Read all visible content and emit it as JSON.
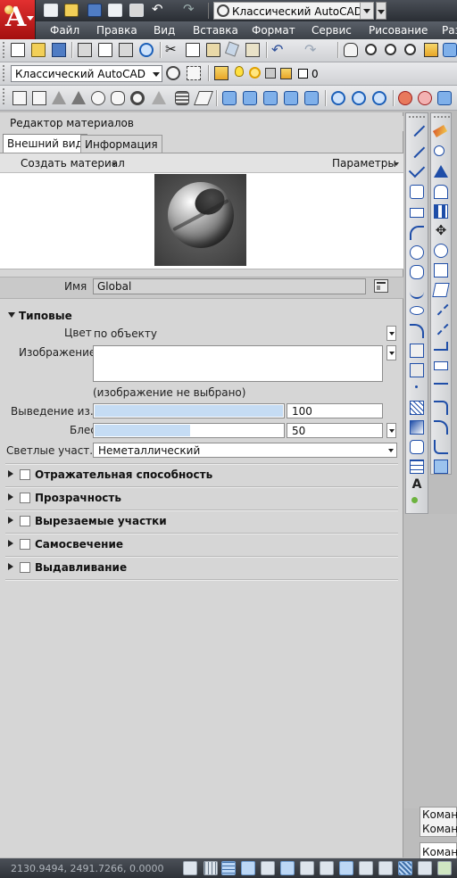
{
  "title_bar": {
    "workspace": "Классический AutoCAD"
  },
  "menu": [
    "Файл",
    "Правка",
    "Вид",
    "Вставка",
    "Формат",
    "Сервис",
    "Рисование",
    "Раз"
  ],
  "workspace_toolbar": {
    "workspace": "Классический AutoCAD",
    "layer_value": "0"
  },
  "palette": {
    "title": "Редактор материалов",
    "tabs": [
      "Внешний вид",
      "Информация"
    ],
    "create_material": "Создать материал",
    "parameters": "Параметры",
    "name_label": "Имя",
    "name_value": "Global",
    "generic_section": "Типовые",
    "color_label": "Цвет",
    "color_value": "по объекту",
    "image_label": "Изображение",
    "image_none": "(изображение не выбрано)",
    "fade_label": "Выведение из...",
    "fade_value": "100",
    "fade_fill": 0.99,
    "gloss_label": "Блеск",
    "gloss_value": "50",
    "gloss_fill": 0.5,
    "highlights_label": "Светлые участ...",
    "highlights_value": "Неметаллический",
    "collapsed_sections": [
      "Отражательная способность",
      "Прозрачность",
      "Вырезаемые участки",
      "Самосвечение",
      "Выдавливание"
    ]
  },
  "command_line": {
    "history": [
      "Команд",
      "Команд"
    ],
    "prompt": "Команд"
  },
  "status_bar": {
    "coordinates": "2130.9494, 2491.7266, 0.0000"
  },
  "colors": {
    "accent_blue": "#1f4ea8",
    "slider_fill": "#c5dcf4",
    "logo_red": "#c41e1e"
  }
}
